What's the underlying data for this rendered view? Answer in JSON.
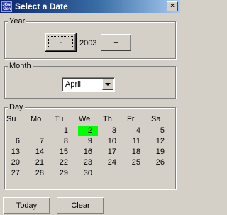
{
  "window": {
    "title": "Select a Date",
    "icon_text": "JGui Gen",
    "close_label": "×"
  },
  "year": {
    "legend": "Year",
    "decrement_label": "-",
    "value": "2003",
    "increment_label": "+"
  },
  "month": {
    "legend": "Month",
    "selected": "April"
  },
  "day": {
    "legend": "Day",
    "weekdays": [
      "Su",
      "Mo",
      "Tu",
      "We",
      "Th",
      "Fr",
      "Sa"
    ],
    "weeks": [
      [
        "",
        "",
        "1",
        "2",
        "3",
        "4",
        "5"
      ],
      [
        "6",
        "7",
        "8",
        "9",
        "10",
        "11",
        "12"
      ],
      [
        "13",
        "14",
        "15",
        "16",
        "17",
        "18",
        "19"
      ],
      [
        "20",
        "21",
        "22",
        "23",
        "24",
        "25",
        "26"
      ],
      [
        "27",
        "28",
        "29",
        "30",
        "",
        "",
        ""
      ]
    ],
    "selected_day": "2",
    "selected_color": "#00ff00"
  },
  "buttons": {
    "today_label": "Today",
    "clear_label": "Clear"
  }
}
